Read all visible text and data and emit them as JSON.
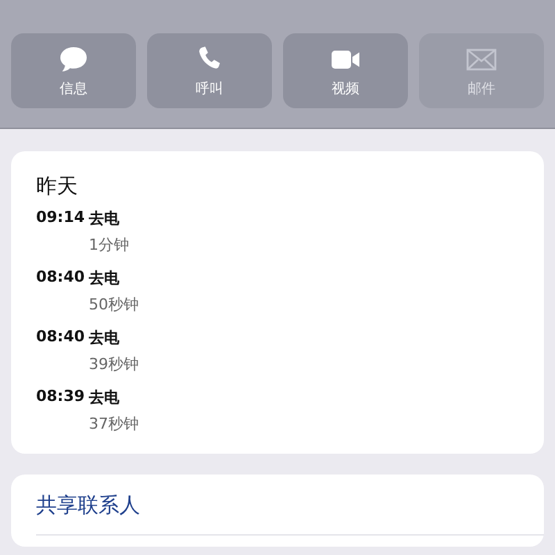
{
  "actions": [
    {
      "kind": "message",
      "label": "信息",
      "disabled": false
    },
    {
      "kind": "call",
      "label": "呼叫",
      "disabled": false
    },
    {
      "kind": "video",
      "label": "视频",
      "disabled": false
    },
    {
      "kind": "mail",
      "label": "邮件",
      "disabled": true
    }
  ],
  "recents": {
    "title": "昨天",
    "calls": [
      {
        "time": "09:14",
        "type": "去电",
        "duration": "1分钟"
      },
      {
        "time": "08:40",
        "type": "去电",
        "duration": "50秒钟"
      },
      {
        "time": "08:40",
        "type": "去电",
        "duration": "39秒钟"
      },
      {
        "time": "08:39",
        "type": "去电",
        "duration": "37秒钟"
      }
    ]
  },
  "share": {
    "label": "共享联系人"
  }
}
